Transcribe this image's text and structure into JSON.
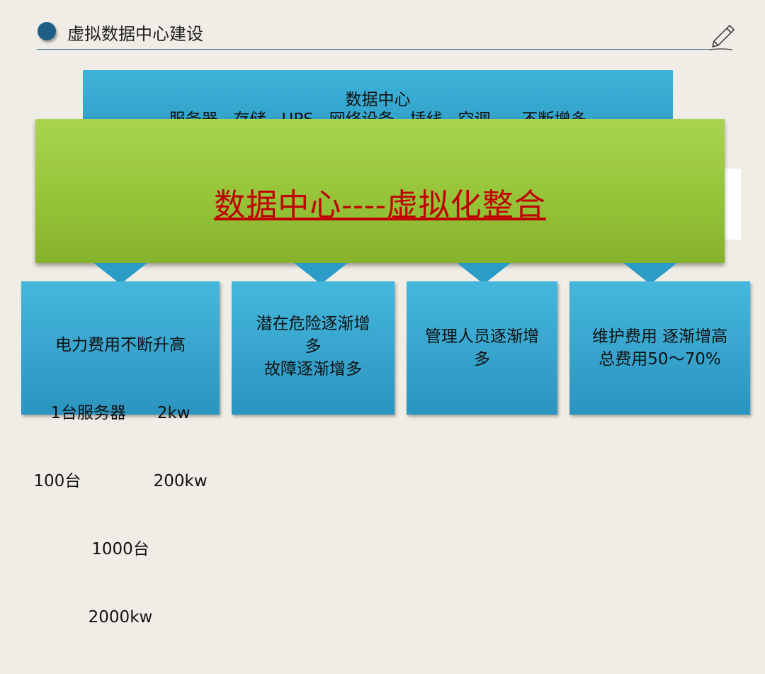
{
  "header": {
    "title": "虚拟数据中心建设"
  },
  "top_box": {
    "line1": "数据中心",
    "line2": "服务器   存储   UPS   网络设备   插线   空调      不断增多"
  },
  "banner": {
    "title": "数据中心----虚拟化整合"
  },
  "cards": [
    {
      "lines": [
        "电力费用不断升高",
        "1台服务器      2kw",
        "100台              200kw",
        "1000台",
        "2000kw"
      ]
    },
    {
      "lines": [
        "潜在危险逐渐增",
        "多",
        "故障逐渐增多"
      ]
    },
    {
      "lines": [
        "管理人员逐渐增",
        "多"
      ]
    },
    {
      "lines": [
        "维护费用 逐渐增高",
        "总费用50～70%"
      ]
    }
  ],
  "colors": {
    "accent": "#1d5f86",
    "banner_green": "#96c438",
    "card_blue": "#3aa9d2",
    "banner_text": "#c00000"
  }
}
